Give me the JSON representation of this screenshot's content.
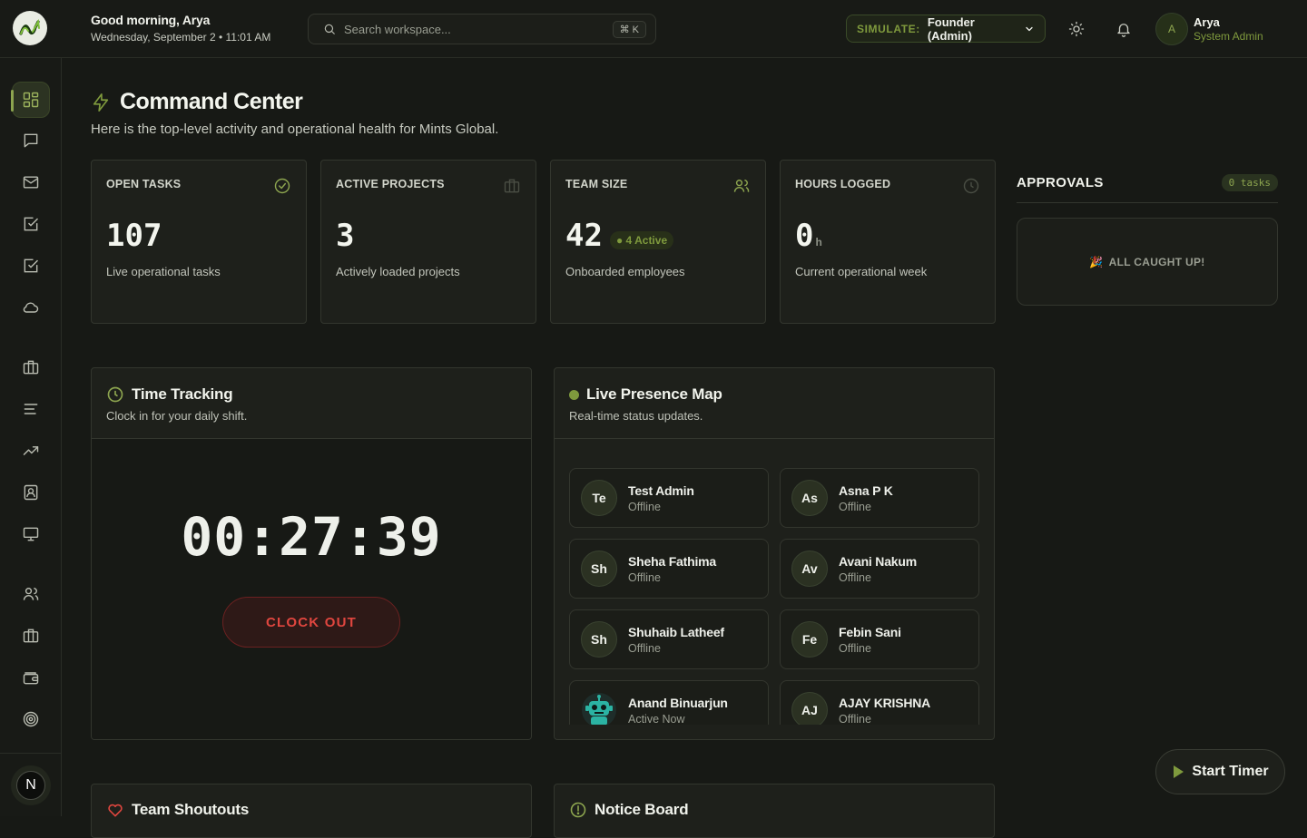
{
  "header": {
    "greeting": "Good morning, Arya",
    "datetime": "Wednesday, September 2 • 11:01 AM",
    "search_placeholder": "Search workspace...",
    "search_shortcut": "⌘ K",
    "simulate_label": "SIMULATE:",
    "simulate_value": "Founder (Admin)",
    "user_initial": "A",
    "user_name": "Arya",
    "user_role": "System Admin"
  },
  "sidebar": {
    "icons": [
      "grid-icon",
      "chat-icon",
      "mail-icon",
      "checkbox-icon",
      "checkbox-icon",
      "cloud-icon",
      "briefcase-icon",
      "list-icon",
      "trending-icon",
      "contact-icon",
      "monitor-icon",
      "users-icon",
      "briefcase-icon",
      "wallet-icon",
      "target-icon"
    ],
    "active_index": 0,
    "badge_letter": "N"
  },
  "page": {
    "title": "Command Center",
    "subtitle": "Here is the top-level activity and operational health for Mints Global."
  },
  "stats": [
    {
      "label": "OPEN TASKS",
      "value": "107",
      "desc": "Live operational tasks",
      "icon": "check-circle-icon"
    },
    {
      "label": "ACTIVE PROJECTS",
      "value": "3",
      "desc": "Actively loaded projects",
      "icon": "briefcase-icon"
    },
    {
      "label": "TEAM SIZE",
      "value": "42",
      "badge": "● 4 Active",
      "desc": "Onboarded employees",
      "icon": "users-icon"
    },
    {
      "label": "HOURS LOGGED",
      "value": "0",
      "unit": "h",
      "desc": "Current operational week",
      "icon": "clock-icon"
    }
  ],
  "approvals": {
    "title": "APPROVALS",
    "count": "0 tasks",
    "empty_text": "ALL CAUGHT UP!",
    "empty_icon": "🎉"
  },
  "time_tracking": {
    "title": "Time Tracking",
    "subtitle": "Clock in for your daily shift.",
    "timer": "00:27:39",
    "button": "CLOCK OUT"
  },
  "presence": {
    "title": "Live Presence Map",
    "subtitle": "Real-time status updates.",
    "people": [
      {
        "initials": "Te",
        "name": "Test Admin",
        "status": "Offline"
      },
      {
        "initials": "As",
        "name": "Asna P K",
        "status": "Offline"
      },
      {
        "initials": "Sh",
        "name": "Sheha Fathima",
        "status": "Offline"
      },
      {
        "initials": "Av",
        "name": "Avani Nakum",
        "status": "Offline"
      },
      {
        "initials": "Sh",
        "name": "Shuhaib Latheef",
        "status": "Offline"
      },
      {
        "initials": "Fe",
        "name": "Febin Sani",
        "status": "Offline"
      },
      {
        "initials": "",
        "name": "Anand Binuarjun",
        "status": "Active Now",
        "robot_avatar": true
      },
      {
        "initials": "AJ",
        "name": "AJAY KRISHNA",
        "status": "Offline"
      }
    ]
  },
  "shoutouts": {
    "title": "Team Shoutouts"
  },
  "notice": {
    "title": "Notice Board"
  },
  "start_timer": {
    "label": "Start Timer"
  },
  "colors": {
    "accent": "#8da54f",
    "danger": "#e0463f",
    "background": "#171915",
    "card": "#1e201b"
  }
}
